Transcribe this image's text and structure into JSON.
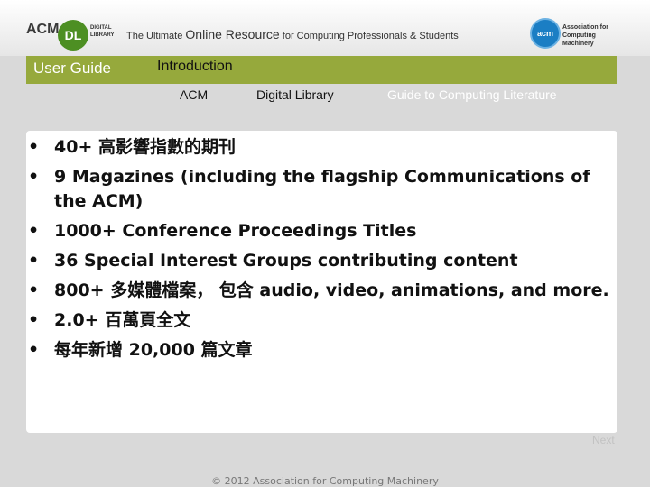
{
  "header": {
    "acm_text": "ACM",
    "dl_text": "DL",
    "dl_sub": "DIGITAL LIBRARY",
    "tagline_pre": "The Ultimate",
    "tagline_big": "Online Resource",
    "tagline_post": "for Computing Professionals & Students",
    "org_logo_text": "acm",
    "org_text": "Association for Computing Machinery"
  },
  "bar": {
    "user_guide": "User Guide",
    "section": "Introduction"
  },
  "tabs": [
    {
      "label": "ACM"
    },
    {
      "label": "Digital Library"
    },
    {
      "label": "Guide to Computing Literature"
    }
  ],
  "content": {
    "bullets": [
      "40+ 高影響指數的期刊",
      "9 Magazines (including the flagship Communications of the ACM)",
      "1000+ Conference Proceedings Titles",
      "36 Special Interest Groups contributing content",
      "800+ 多媒體檔案， 包含 audio, video, animations, and more.",
      "2.0+ 百萬頁全文",
      "每年新增 20,000 篇文章"
    ]
  },
  "nav": {
    "next_label": "Next"
  },
  "footer": {
    "copyright": "© 2012 Association for Computing Machinery"
  },
  "colors": {
    "accent_green": "#96a93c",
    "dl_green": "#4d8f23",
    "acm_blue": "#1b7ec4"
  }
}
